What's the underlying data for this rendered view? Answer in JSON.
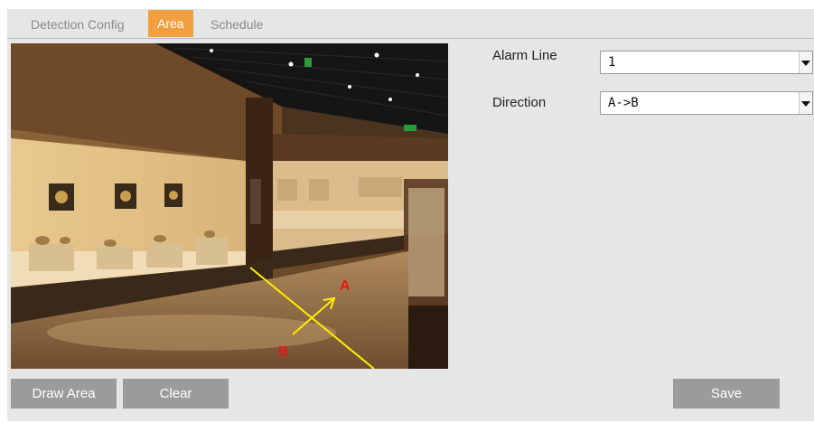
{
  "tabs": [
    {
      "label": "Detection Config",
      "active": false
    },
    {
      "label": "Area",
      "active": true
    },
    {
      "label": "Schedule",
      "active": false
    }
  ],
  "preview": {
    "label_a": "A",
    "label_b": "B"
  },
  "fields": {
    "alarm_line": {
      "label": "Alarm Line",
      "value": "1"
    },
    "direction": {
      "label": "Direction",
      "value": "A->B"
    }
  },
  "buttons": {
    "draw_area": "Draw Area",
    "clear": "Clear",
    "save": "Save"
  },
  "colors": {
    "active_tab": "#f0a040",
    "button_bg": "#9b9b9b",
    "line_color": "#ffee00",
    "label_color": "#e01818"
  }
}
